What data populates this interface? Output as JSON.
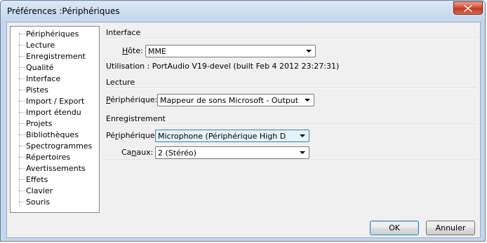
{
  "window": {
    "title": "Préférences :Périphériques"
  },
  "sidebar": {
    "items": [
      {
        "label": "Périphériques"
      },
      {
        "label": "Lecture"
      },
      {
        "label": "Enregistrement"
      },
      {
        "label": "Qualité"
      },
      {
        "label": "Interface"
      },
      {
        "label": "Pistes"
      },
      {
        "label": "Import / Export"
      },
      {
        "label": "Import étendu"
      },
      {
        "label": "Projets"
      },
      {
        "label": "Bibliothèques"
      },
      {
        "label": "Spectrogrammes"
      },
      {
        "label": "Répertoires"
      },
      {
        "label": "Avertissements"
      },
      {
        "label": "Effets"
      },
      {
        "label": "Clavier"
      },
      {
        "label": "Souris"
      }
    ]
  },
  "interface": {
    "title": "Interface",
    "host_label": "Hôte:",
    "host_value": "MME",
    "usage_text": "Utilisation : PortAudio V19-devel (built Feb  4 2012 23:27:31)"
  },
  "playback": {
    "title": "Lecture",
    "device_label": "Périphérique:",
    "device_value": "Mappeur de sons Microsoft - Output"
  },
  "recording": {
    "title": "Enregistrement",
    "device_label": "Périphérique:",
    "device_value": "Microphone (Périphérique High D",
    "channels_label": "Canaux:",
    "channels_value": "2 (Stéréo)"
  },
  "buttons": {
    "ok": "OK",
    "cancel": "Annuler"
  },
  "colors": {
    "focus_border": "#3c7fb1",
    "close_red": "#d4472e"
  }
}
